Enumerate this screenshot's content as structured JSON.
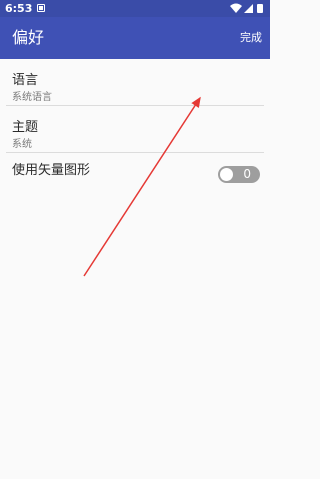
{
  "status_bar": {
    "time": "6:53",
    "icons": [
      "notification-icon",
      "wifi-icon",
      "signal-icon",
      "battery-icon"
    ]
  },
  "app_bar": {
    "title": "偏好",
    "done_label": "完成",
    "color": "#3f51b5"
  },
  "preferences": [
    {
      "title": "语言",
      "summary": "系统语言"
    },
    {
      "title": "主题",
      "summary": "系统"
    },
    {
      "title": "使用矢量图形",
      "toggle_text": "0"
    }
  ],
  "annotation": {
    "arrow_color": "#e53935"
  }
}
